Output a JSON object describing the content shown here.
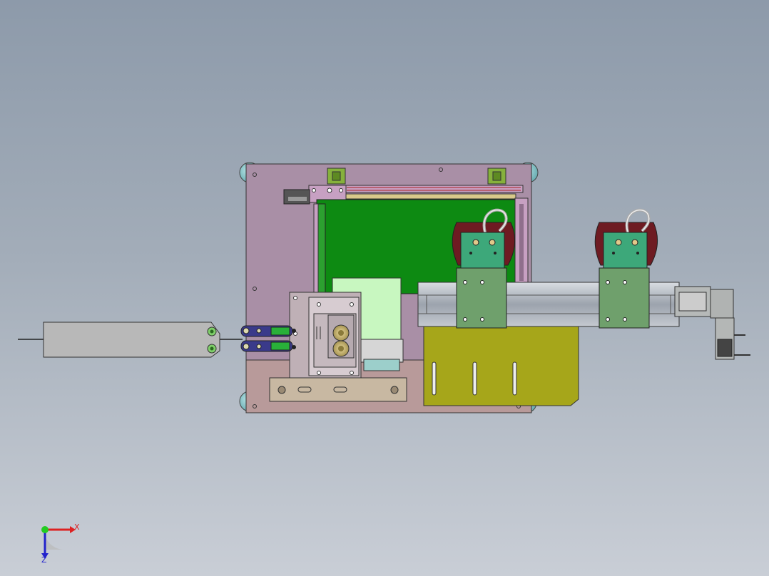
{
  "scene": {
    "background_top": "#8d9aaa",
    "background_bottom": "#c9ced6",
    "colors": {
      "base_plate": "#a98fa6",
      "frame_pink": "#c7a0c2",
      "pcb_green": "#0d8a12",
      "table_yellow": "#a6a61a",
      "carriage_green": "#6fa06c",
      "bracket_tan": "#b8a894",
      "rail_gray": "#aeb4bd",
      "cable_red": "#6e1b22",
      "foot_cyan": "#7ec4c8"
    }
  },
  "triad": {
    "x_label": "X",
    "z_label": "Z"
  }
}
